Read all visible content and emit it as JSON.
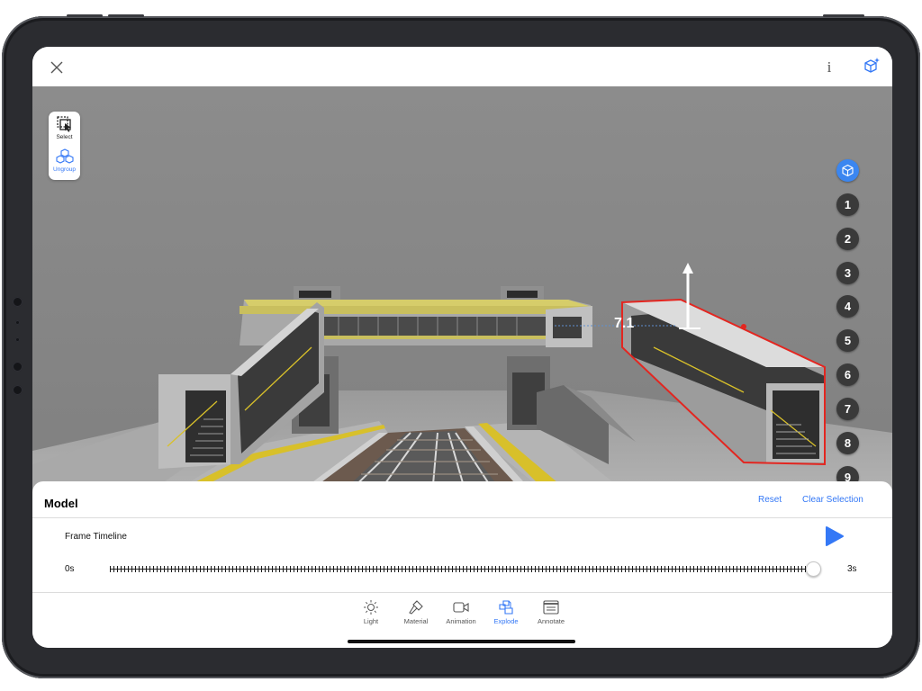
{
  "colors": {
    "accent": "#3478f6",
    "selection": "#e32620",
    "step_bg": "#3a3a3a",
    "step_active_bg": "#3b86f0",
    "viewport_bg": "#8b8b8b"
  },
  "topbar": {
    "close_icon": "close-icon",
    "info_label": "i",
    "ar_icon": "ar-cube-icon"
  },
  "tools": {
    "select_label": "Select",
    "ungroup_label": "Ungroup"
  },
  "steps": [
    {
      "label": "",
      "icon": "view-cube-icon",
      "active": true
    },
    {
      "label": "1"
    },
    {
      "label": "2"
    },
    {
      "label": "3"
    },
    {
      "label": "4"
    },
    {
      "label": "5"
    },
    {
      "label": "6"
    },
    {
      "label": "7"
    },
    {
      "label": "8"
    },
    {
      "label": "9"
    }
  ],
  "viewport": {
    "dimension_value": "7.1"
  },
  "panel": {
    "title": "Model",
    "reset_label": "Reset",
    "clear_label": "Clear Selection",
    "timeline_label": "Frame Timeline",
    "time_start": "0s",
    "time_end": "3s",
    "progress": 1.0
  },
  "bottom_toolbar": [
    {
      "label": "Light",
      "icon": "light-icon",
      "active": false
    },
    {
      "label": "Material",
      "icon": "material-icon",
      "active": false
    },
    {
      "label": "Animation",
      "icon": "animation-icon",
      "active": false
    },
    {
      "label": "Explode",
      "icon": "explode-icon",
      "active": true
    },
    {
      "label": "Annotate",
      "icon": "annotate-icon",
      "active": false
    }
  ]
}
